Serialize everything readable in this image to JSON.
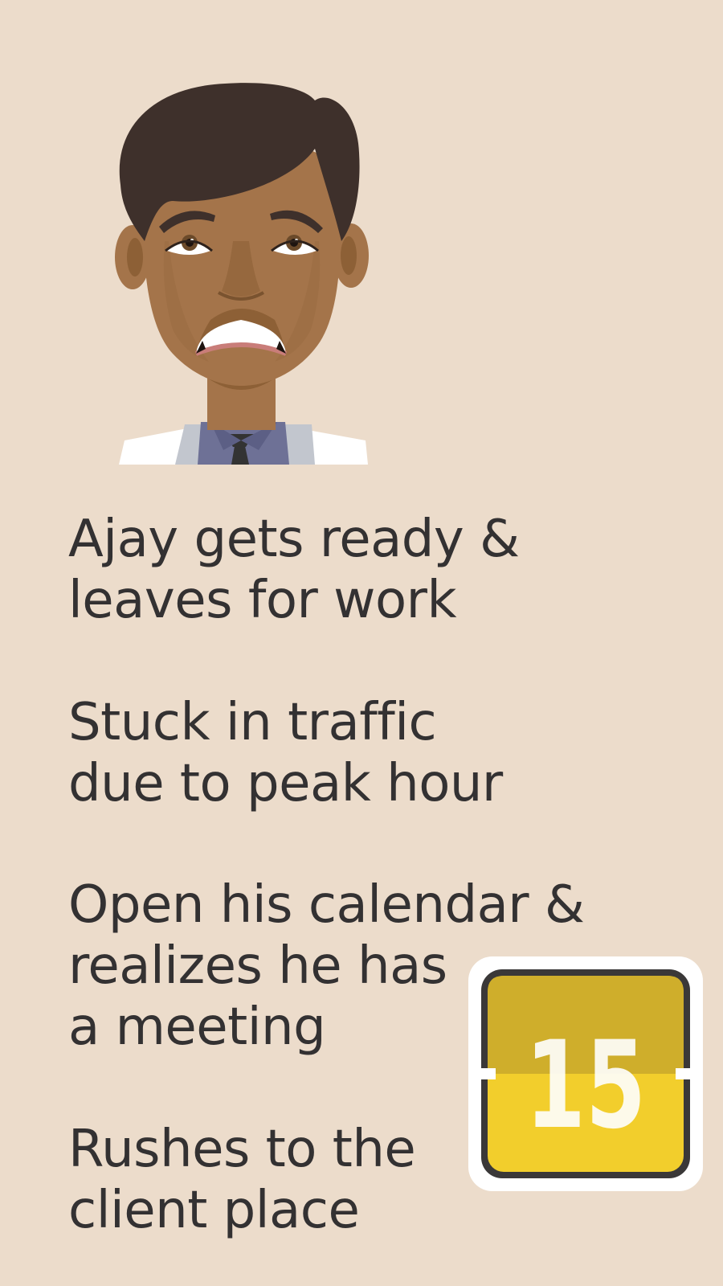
{
  "character": {
    "name": "Ajay",
    "expression": "worried"
  },
  "steps": [
    {
      "lines": [
        "Ajay gets ready &",
        "leaves for work"
      ]
    },
    {
      "lines": [
        "Stuck in traffic",
        "due to peak hour"
      ]
    },
    {
      "lines": [
        "Open his calendar &",
        "realizes he has",
        "a meeting"
      ]
    },
    {
      "lines": [
        "Rushes to the",
        "client place"
      ]
    }
  ],
  "calendar": {
    "number": "15",
    "icon": "flip-calendar-icon",
    "colors": {
      "top": "#cfae2b",
      "bottom": "#f2ce2c",
      "border": "#3a3838",
      "outline": "#ffffff",
      "number": "#ffffff"
    }
  },
  "colors": {
    "background": "#ecdccb",
    "text": "#333132"
  }
}
